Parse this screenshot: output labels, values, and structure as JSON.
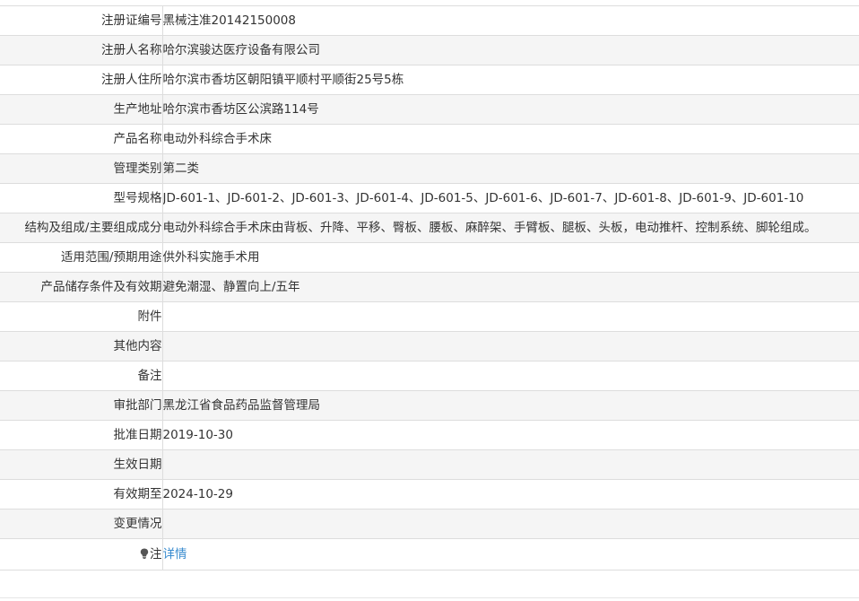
{
  "rows": [
    {
      "label": "注册证编号",
      "value": "黑械注准20142150008"
    },
    {
      "label": "注册人名称",
      "value": "哈尔滨骏达医疗设备有限公司"
    },
    {
      "label": "注册人住所",
      "value": "哈尔滨市香坊区朝阳镇平顺村平顺街25号5栋"
    },
    {
      "label": "生产地址",
      "value": "哈尔滨市香坊区公滨路114号"
    },
    {
      "label": "产品名称",
      "value": "电动外科综合手术床"
    },
    {
      "label": "管理类别",
      "value": "第二类"
    },
    {
      "label": "型号规格",
      "value": "JD-601-1、JD-601-2、JD-601-3、JD-601-4、JD-601-5、JD-601-6、JD-601-7、JD-601-8、JD-601-9、JD-601-10"
    },
    {
      "label": "结构及组成/主要组成成分",
      "value": "电动外科综合手术床由背板、升降、平移、臀板、腰板、麻醉架、手臂板、腿板、头板，电动推杆、控制系统、脚轮组成。"
    },
    {
      "label": "适用范围/预期用途",
      "value": "供外科实施手术用"
    },
    {
      "label": "产品储存条件及有效期",
      "value": "避免潮湿、静置向上/五年"
    },
    {
      "label": "附件",
      "value": ""
    },
    {
      "label": "其他内容",
      "value": ""
    },
    {
      "label": "备注",
      "value": ""
    },
    {
      "label": "审批部门",
      "value": "黑龙江省食品药品监督管理局"
    },
    {
      "label": "批准日期",
      "value": "2019-10-30"
    },
    {
      "label": "生效日期",
      "value": ""
    },
    {
      "label": "有效期至",
      "value": "2024-10-29"
    },
    {
      "label": "变更情况",
      "value": ""
    }
  ],
  "note": {
    "icon": "lightbulb-icon",
    "label": "注",
    "link_text": "详情"
  },
  "colors": {
    "border": "#dddddd",
    "stripe": "#f5f5f5",
    "text": "#333333",
    "link": "#3a8ccf"
  }
}
